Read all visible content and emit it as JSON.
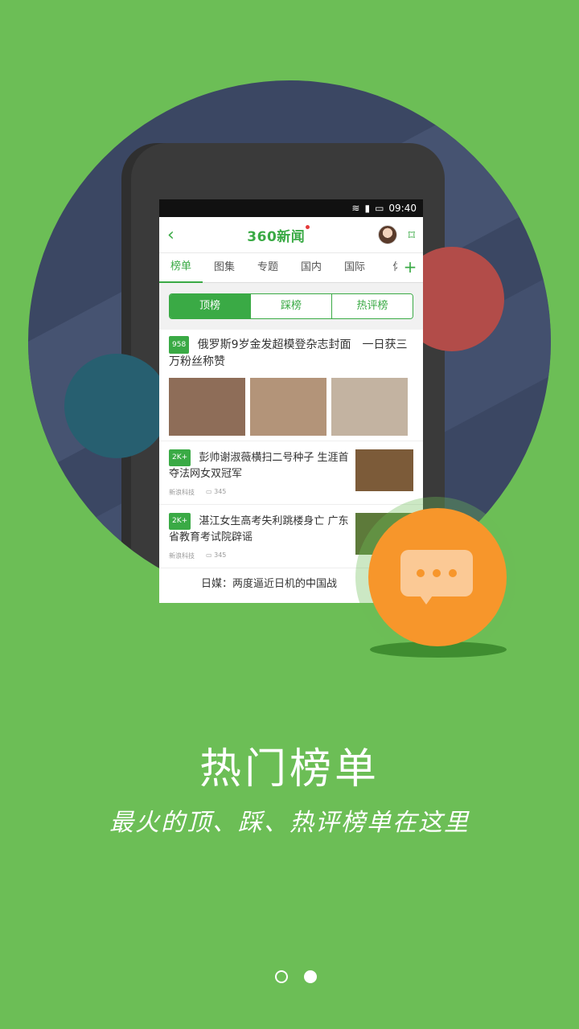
{
  "app": {
    "brand_title": "360新闻",
    "status_time": "09:40"
  },
  "tabs": [
    "榜单",
    "图集",
    "专题",
    "国内",
    "国际",
    "体"
  ],
  "tab_plus": "+",
  "segments": [
    "顶榜",
    "踩榜",
    "热评榜"
  ],
  "news": [
    {
      "badge": "958",
      "title": "俄罗斯9岁金发超模登杂志封面　一日获三万粉丝称赞"
    },
    {
      "badge": "2K+",
      "title": "彭帅谢淑薇横扫二号种子 生涯首夺法网女双冠军",
      "source": "新浪科技",
      "comments": "345"
    },
    {
      "badge": "2K+",
      "title": "湛江女生高考失利跳楼身亡 广东省教育考试院辟谣",
      "source": "新浪科技",
      "comments": "345"
    },
    {
      "title": "日媒：两度逼近日机的中国战"
    }
  ],
  "headline": "热门榜单",
  "subline": "最火的顶、踩、热评榜单在这里",
  "pager": {
    "total": 2,
    "current": 2
  },
  "colors": {
    "background": "#6cbe56",
    "circle": "#3b4763",
    "accent": "#3aaa45",
    "orange": "#f7962b"
  }
}
